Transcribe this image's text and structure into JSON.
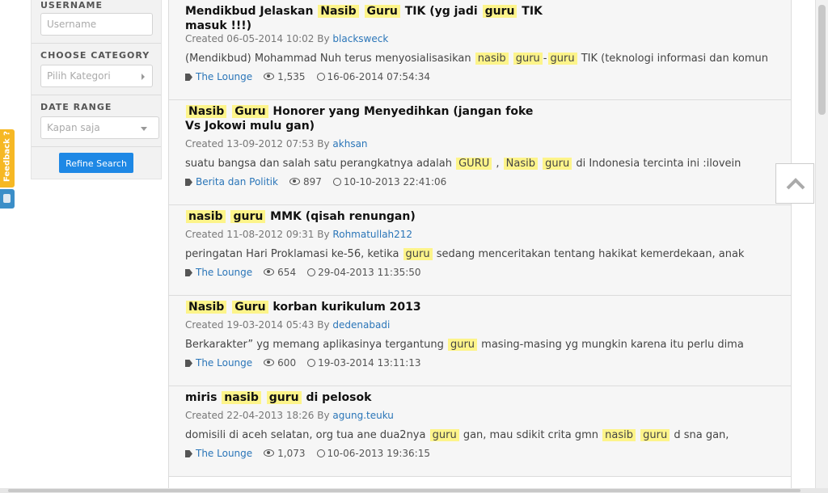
{
  "filters": {
    "username_label": "USERNAME",
    "username_placeholder": "Username",
    "category_label": "CHOOSE CATEGORY",
    "category_value": "Pilih Kategori",
    "date_label": "DATE RANGE",
    "date_value": "Kapan saja",
    "refine_button": "Refine Search"
  },
  "feedback_tab": "Feedback ?",
  "results": [
    {
      "title_parts": [
        {
          "t": "Mendikbud Jelaskan "
        },
        {
          "t": "Nasib",
          "hl": true
        },
        {
          "t": " "
        },
        {
          "t": "Guru",
          "hl": true
        },
        {
          "t": " TIK (yg jadi "
        },
        {
          "t": "guru",
          "hl": true
        },
        {
          "t": " TIK masuk !!!)"
        }
      ],
      "created": "Created 06-05-2014 10:02 By",
      "author": "blacksweck",
      "snippet_parts": [
        {
          "t": "(Mendikbud) Mohammad Nuh terus menyosialisasikan "
        },
        {
          "t": "nasib",
          "hl": true
        },
        {
          "t": " "
        },
        {
          "t": "guru",
          "hl": true
        },
        {
          "t": "-"
        },
        {
          "t": "guru",
          "hl": true
        },
        {
          "t": " TIK (teknologi informasi dan komun"
        }
      ],
      "category": "The Lounge",
      "views": "1,535",
      "last_post": "16-06-2014 07:54:34"
    },
    {
      "title_parts": [
        {
          "t": "Nasib",
          "hl": true
        },
        {
          "t": " "
        },
        {
          "t": "Guru",
          "hl": true
        },
        {
          "t": " Honorer yang Menyedihkan (jangan foke Vs Jokowi mulu gan)"
        }
      ],
      "created": "Created 13-09-2012 07:53 By",
      "author": "akhsan",
      "snippet_parts": [
        {
          "t": "suatu bangsa dan salah satu perangkatnya adalah "
        },
        {
          "t": "GURU",
          "hl": true
        },
        {
          "t": " , "
        },
        {
          "t": "Nasib",
          "hl": true
        },
        {
          "t": " "
        },
        {
          "t": "guru",
          "hl": true
        },
        {
          "t": " di Indonesia tercinta ini :ilovein"
        }
      ],
      "category": "Berita dan Politik",
      "views": "897",
      "last_post": "10-10-2013 22:41:06"
    },
    {
      "title_parts": [
        {
          "t": "nasib",
          "hl": true
        },
        {
          "t": " "
        },
        {
          "t": "guru",
          "hl": true
        },
        {
          "t": " MMK (qisah renungan)"
        }
      ],
      "created": "Created 11-08-2012 09:31 By",
      "author": "Rohmatullah212",
      "snippet_parts": [
        {
          "t": "peringatan Hari Proklamasi ke-56, ketika "
        },
        {
          "t": "guru",
          "hl": true
        },
        {
          "t": " sedang menceritakan tentang hakikat kemerdekaan, anak"
        }
      ],
      "category": "The Lounge",
      "views": "654",
      "last_post": "29-04-2013 11:35:50"
    },
    {
      "title_parts": [
        {
          "t": "Nasib",
          "hl": true
        },
        {
          "t": " "
        },
        {
          "t": "Guru",
          "hl": true
        },
        {
          "t": " korban kurikulum 2013"
        }
      ],
      "created": "Created 19-03-2014 05:43 By",
      "author": "dedenabadi",
      "snippet_parts": [
        {
          "t": "Berkarakter” yg memang aplikasinya tergantung "
        },
        {
          "t": "guru",
          "hl": true
        },
        {
          "t": " masing-masing yg mungkin karena itu perlu dima"
        }
      ],
      "category": "The Lounge",
      "views": "600",
      "last_post": "19-03-2014 13:11:13"
    },
    {
      "title_parts": [
        {
          "t": "miris "
        },
        {
          "t": "nasib",
          "hl": true
        },
        {
          "t": " "
        },
        {
          "t": "guru",
          "hl": true
        },
        {
          "t": " di pelosok"
        }
      ],
      "created": "Created 22-04-2013 18:26 By",
      "author": "agung.teuku",
      "snippet_parts": [
        {
          "t": "domisili di aceh selatan, org tua ane dua2nya "
        },
        {
          "t": "guru",
          "hl": true
        },
        {
          "t": " gan, mau sdikit crita gmn "
        },
        {
          "t": "nasib",
          "hl": true
        },
        {
          "t": " "
        },
        {
          "t": "guru",
          "hl": true
        },
        {
          "t": " d sna gan,"
        }
      ],
      "category": "The Lounge",
      "views": "1,073",
      "last_post": "10-06-2013 19:36:15"
    }
  ]
}
